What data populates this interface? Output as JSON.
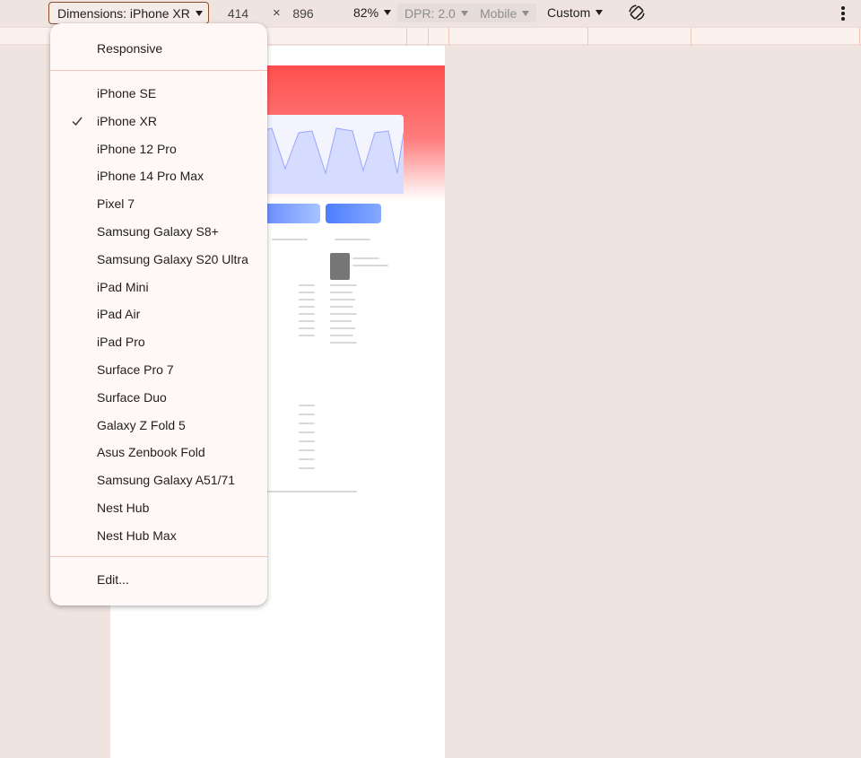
{
  "toolbar": {
    "dimensions_label": "Dimensions: iPhone XR",
    "width": "414",
    "times": "×",
    "height": "896",
    "zoom": "82%",
    "dpr": "DPR: 2.0",
    "device_type": "Mobile",
    "throttling": "Custom"
  },
  "menu": {
    "responsive": "Responsive",
    "devices": [
      "iPhone SE",
      "iPhone XR",
      "iPhone 12 Pro",
      "iPhone 14 Pro Max",
      "Pixel 7",
      "Samsung Galaxy S8+",
      "Samsung Galaxy S20 Ultra",
      "iPad Mini",
      "iPad Air",
      "iPad Pro",
      "Surface Pro 7",
      "Surface Duo",
      "Galaxy Z Fold 5",
      "Asus Zenbook Fold",
      "Samsung Galaxy A51/71",
      "Nest Hub",
      "Nest Hub Max"
    ],
    "selected": "iPhone XR",
    "edit": "Edit..."
  },
  "colors": {
    "accent": "#8a4b2c",
    "page_bg": "#efe4e0",
    "menu_bg": "#fff8f7",
    "separator": "#f2c8b8"
  },
  "icons": {
    "rotate": "rotate-icon",
    "more": "more-vert-icon",
    "check": "check-icon",
    "caret": "caret-down-icon"
  }
}
